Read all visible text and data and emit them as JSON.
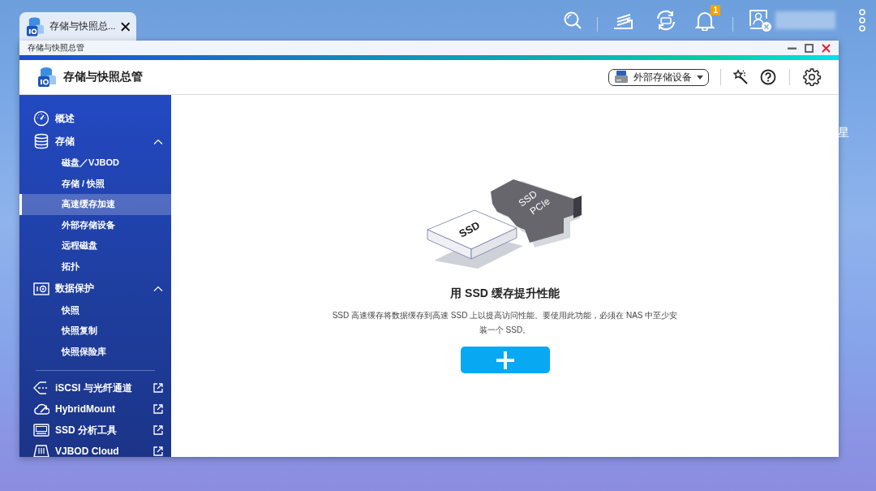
{
  "desktop": {
    "tab": {
      "title": "存储与快照总..."
    },
    "notification_badge": "1",
    "edge_label": "星"
  },
  "window": {
    "title": "存储与快照总管",
    "app_title": "存储与快照总管",
    "device_dropdown": "外部存储设备"
  },
  "sidebar": {
    "items": [
      {
        "kind": "section",
        "label": "概述"
      },
      {
        "kind": "section",
        "label": "存储",
        "expanded": true,
        "children": [
          {
            "label": "磁盘／VJBOD",
            "selected": false
          },
          {
            "label": "存储 / 快照",
            "selected": false
          },
          {
            "label": "高速缓存加速",
            "selected": true
          },
          {
            "label": "外部存储设备",
            "selected": false
          },
          {
            "label": "远程磁盘",
            "selected": false
          },
          {
            "label": "拓扑",
            "selected": false
          }
        ]
      },
      {
        "kind": "section",
        "label": "数据保护",
        "expanded": true,
        "children": [
          {
            "label": "快照",
            "selected": false
          },
          {
            "label": "快照复制",
            "selected": false
          },
          {
            "label": "快照保险库",
            "selected": false
          }
        ]
      },
      {
        "kind": "external",
        "label": "iSCSI 与光纤通道"
      },
      {
        "kind": "external",
        "label": "HybridMount"
      },
      {
        "kind": "external",
        "label": "SSD 分析工具"
      },
      {
        "kind": "external",
        "label": "VJBOD Cloud"
      }
    ]
  },
  "content": {
    "illustration_labels": [
      "SSD",
      "SSD",
      "PCIe"
    ],
    "title": "用 SSD 缓存提升性能",
    "description": "SSD 高速缓存将数据缓存到高速 SSD 上以提高访问性能。要使用此功能，必须在 NAS 中至少安装一个 SSD。"
  }
}
